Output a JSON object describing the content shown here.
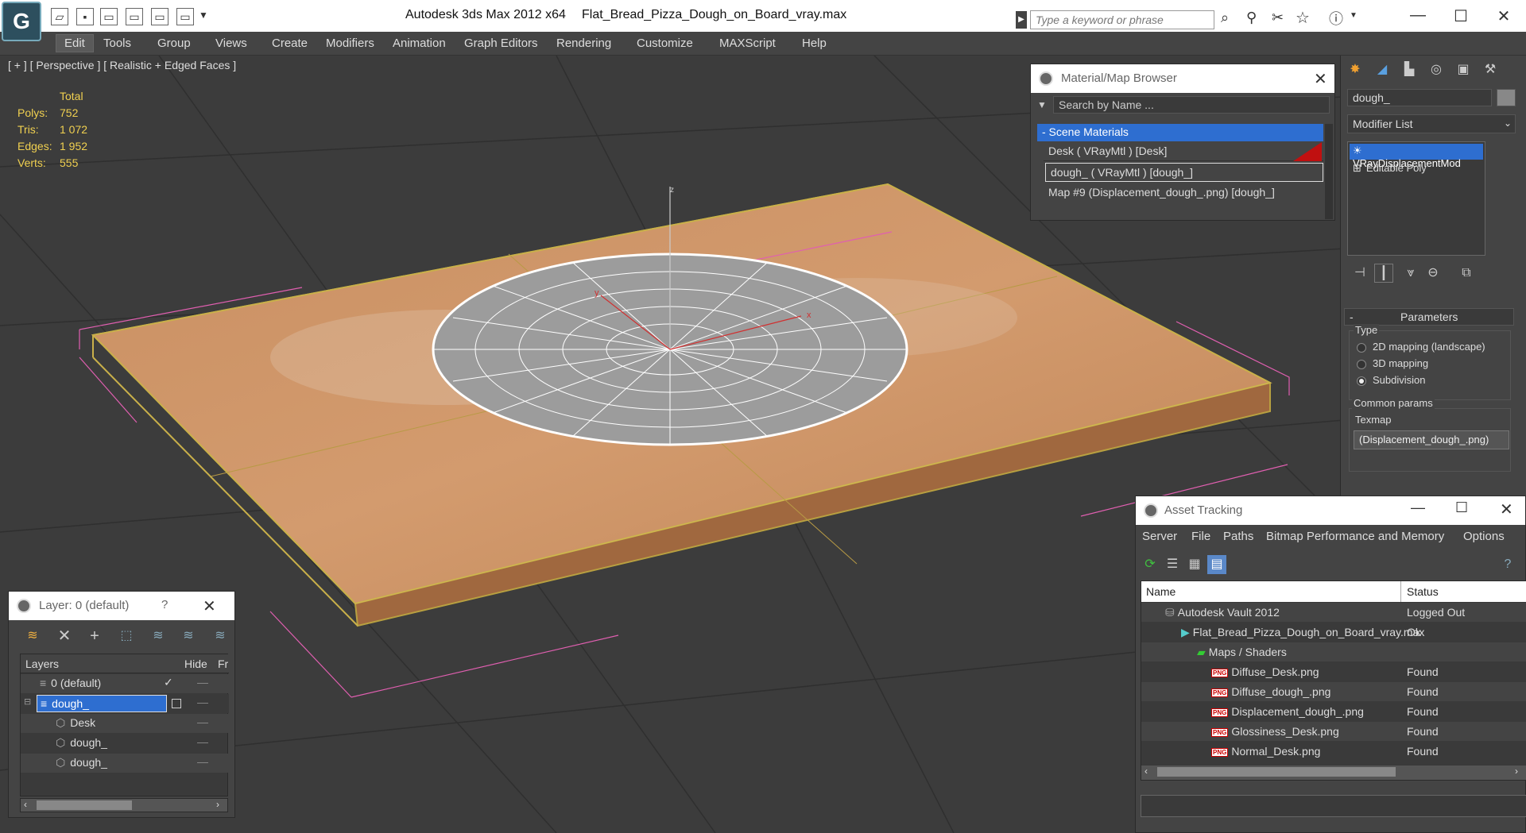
{
  "titlebar": {
    "app_title": "Autodesk 3ds Max  2012 x64",
    "file_name": "Flat_Bread_Pizza_Dough_on_Board_vray.max",
    "search_placeholder": "Type a keyword or phrase"
  },
  "menu": [
    "Edit",
    "Tools",
    "Group",
    "Views",
    "Create",
    "Modifiers",
    "Animation",
    "Graph Editors",
    "Rendering",
    "Customize",
    "MAXScript",
    "Help"
  ],
  "viewport": {
    "label": "[ + ] [ Perspective ] [ Realistic + Edged Faces ]",
    "stats_header": "Total",
    "stats": [
      {
        "label": "Polys:",
        "value": "752"
      },
      {
        "label": "Tris:",
        "value": "1 072"
      },
      {
        "label": "Edges:",
        "value": "1 952"
      },
      {
        "label": "Verts:",
        "value": "555"
      }
    ],
    "axis_labels": {
      "z": "z",
      "x": "x",
      "y": "y"
    }
  },
  "material_browser": {
    "title": "Material/Map Browser",
    "search_placeholder": "Search by Name ...",
    "section": "- Scene Materials",
    "items": [
      "Desk  ( VRayMtl ) [Desk]",
      "dough_  ( VRayMtl ) [dough_]",
      "Map #9 (Displacement_dough_.png) [dough_]"
    ]
  },
  "command_panel": {
    "object_name": "dough_",
    "modifier_list": "Modifier List",
    "stack": [
      "VRayDisplacementMod",
      "Editable Poly"
    ],
    "parameters_title": "Parameters",
    "type_label": "Type",
    "type_options": [
      "2D mapping (landscape)",
      "3D mapping",
      "Subdivision"
    ],
    "type_selected": 2,
    "common_params": "Common params",
    "texmap_label": "Texmap",
    "texmap_value": "(Displacement_dough_.png)"
  },
  "layer_panel": {
    "title": "Layer: 0 (default)",
    "help": "?",
    "col_layers": "Layers",
    "col_hide": "Hide",
    "col_fr": "Fr",
    "rows": [
      {
        "name": "0 (default)",
        "indent": 0,
        "checked": true
      },
      {
        "name": "dough_",
        "indent": 0,
        "selected": true
      },
      {
        "name": "Desk",
        "indent": 1
      },
      {
        "name": "dough_",
        "indent": 1
      },
      {
        "name": "dough_",
        "indent": 1
      }
    ]
  },
  "asset_tracking": {
    "title": "Asset Tracking",
    "menu": [
      "Server",
      "File",
      "Paths",
      "Bitmap Performance and Memory",
      "Options"
    ],
    "col_name": "Name",
    "col_status": "Status",
    "rows": [
      {
        "name": "Autodesk Vault 2012",
        "status": "Logged Out",
        "level": 0,
        "icon": "vault"
      },
      {
        "name": "Flat_Bread_Pizza_Dough_on_Board_vray.max",
        "status": "Ok",
        "level": 1,
        "icon": "max"
      },
      {
        "name": "Maps / Shaders",
        "status": "",
        "level": 2,
        "icon": "maps"
      },
      {
        "name": "Diffuse_Desk.png",
        "status": "Found",
        "level": 3,
        "icon": "png"
      },
      {
        "name": "Diffuse_dough_.png",
        "status": "Found",
        "level": 3,
        "icon": "png"
      },
      {
        "name": "Displacement_dough_.png",
        "status": "Found",
        "level": 3,
        "icon": "png"
      },
      {
        "name": "Glossiness_Desk.png",
        "status": "Found",
        "level": 3,
        "icon": "png"
      },
      {
        "name": "Normal_Desk.png",
        "status": "Found",
        "level": 3,
        "icon": "png"
      }
    ]
  }
}
